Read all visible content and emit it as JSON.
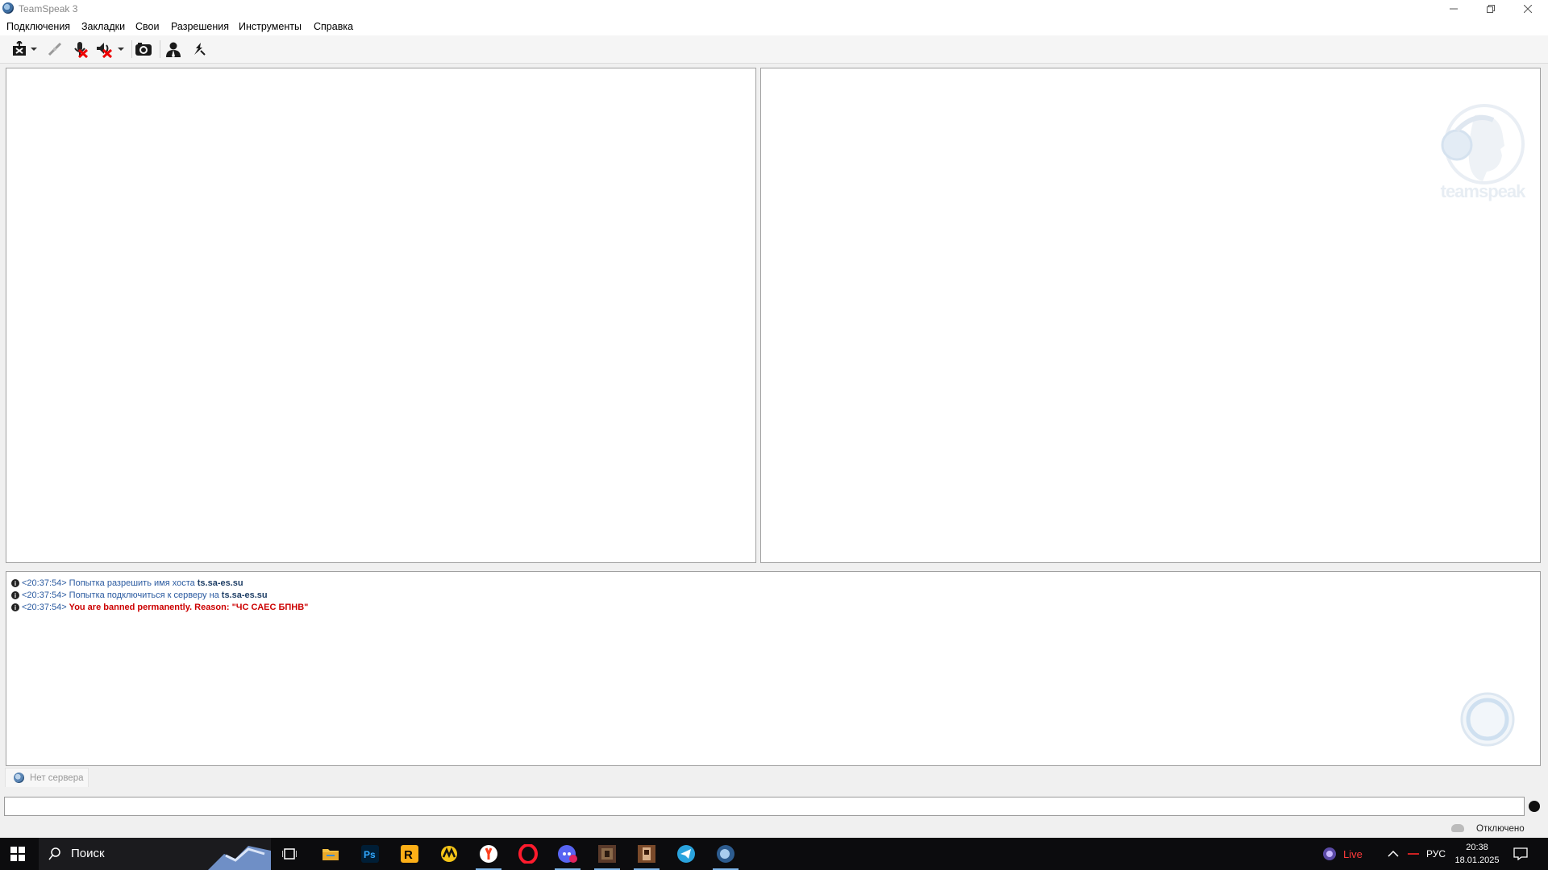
{
  "window": {
    "title": "TeamSpeak 3"
  },
  "menu": [
    "Подключения",
    "Закладки",
    "Свои",
    "Разрешения",
    "Инструменты",
    "Справка"
  ],
  "toolbar": {
    "icons": [
      "connect-icon",
      "dropdown-icon",
      "disconnect-icon",
      "mute-mic-icon",
      "mute-speaker-icon",
      "dropdown-icon",
      "away-icon",
      "contacts-icon",
      "subscribe-icon"
    ]
  },
  "watermark": {
    "brand": "teamspeak"
  },
  "log": [
    {
      "time": "<20:37:54>",
      "text": "Попытка разрешить имя хоста",
      "host": "ts.sa-es.su"
    },
    {
      "time": "<20:37:54>",
      "text": "Попытка подключиться к серверу на",
      "host": "ts.sa-es.su"
    },
    {
      "time": "<20:37:54>",
      "banned": "You are banned permanently. Reason: \"ЧС САЕС БПНВ\""
    }
  ],
  "server_tab": {
    "label": "Нет сервера"
  },
  "chat": {
    "placeholder": ""
  },
  "status": {
    "text": "Отключено"
  },
  "taskbar": {
    "search_label": "Поиск",
    "apps": [
      "start-icon",
      "task-view-icon",
      "file-explorer-icon",
      "photoshop-icon",
      "rockstar-icon",
      "game-icon",
      "yandex-browser-icon",
      "opera-icon",
      "discord-icon",
      "game-app-icon",
      "game-app2-icon",
      "telegram-icon",
      "teamspeak-icon"
    ],
    "live_label": "Live",
    "lang": "РУС",
    "time": "20:38",
    "date": "18.01.2025"
  }
}
